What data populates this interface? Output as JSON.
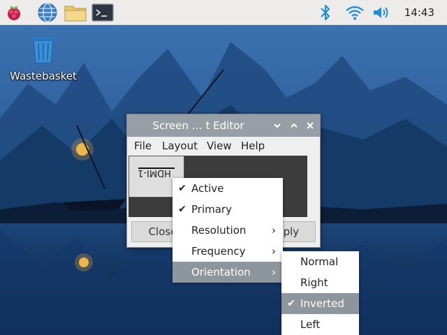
{
  "taskbar": {
    "icons": [
      "raspberry-menu-icon",
      "web-browser-icon",
      "file-manager-icon",
      "terminal-icon"
    ],
    "tray_icons": [
      "bluetooth-icon",
      "wifi-icon",
      "volume-icon"
    ],
    "clock": "14:43"
  },
  "desktop": {
    "wastebasket_label": "Wastebasket"
  },
  "window": {
    "title": "Screen … t Editor",
    "menus": [
      "File",
      "Layout",
      "View",
      "Help"
    ],
    "monitor_label": "HDMI-1",
    "close_label": "Close",
    "apply_label": "Apply"
  },
  "context_menu": {
    "items": [
      {
        "label": "Active",
        "checked": true,
        "submenu": false
      },
      {
        "label": "Primary",
        "checked": true,
        "submenu": false
      },
      {
        "label": "Resolution",
        "checked": false,
        "submenu": true
      },
      {
        "label": "Frequency",
        "checked": false,
        "submenu": true
      },
      {
        "label": "Orientation",
        "checked": false,
        "submenu": true,
        "highlighted": true
      }
    ]
  },
  "orientation_menu": {
    "items": [
      {
        "label": "Normal",
        "checked": false
      },
      {
        "label": "Right",
        "checked": false
      },
      {
        "label": "Inverted",
        "checked": true,
        "highlighted": true
      },
      {
        "label": "Left",
        "checked": false
      }
    ]
  },
  "colors": {
    "taskbar": "#edeceb",
    "titlebar": "#979ea5",
    "menu_highlight": "#8d959d",
    "bluetooth": "#1f8fdc"
  }
}
